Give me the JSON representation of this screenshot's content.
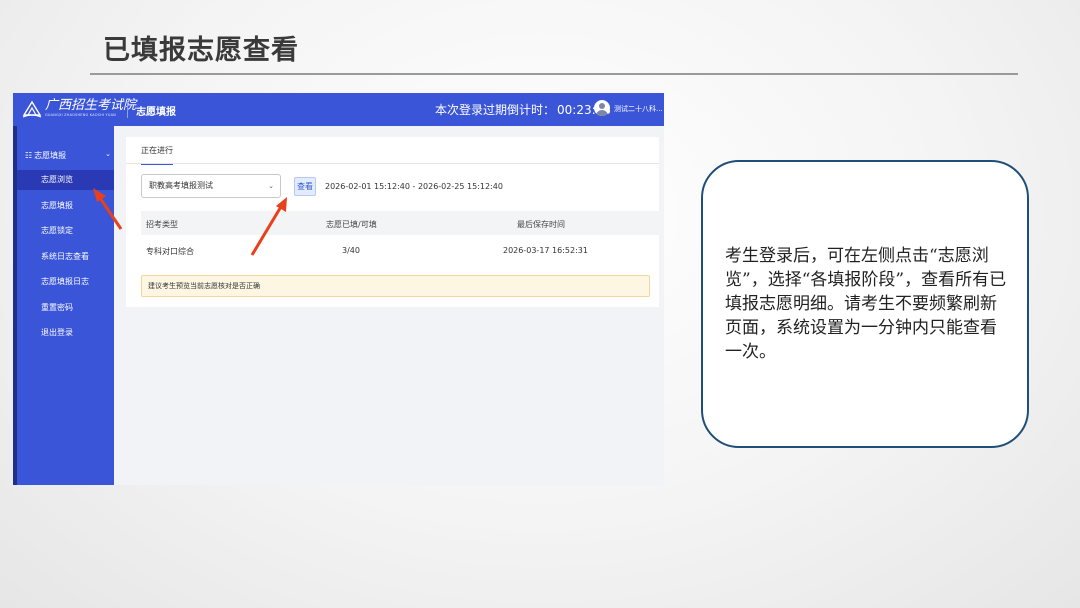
{
  "slide": {
    "title": "已填报志愿查看",
    "description": "考生登录后，可在左侧点击“志愿浏览”，选择“各填报阶段”，查看所有已填报志愿明细。请考生不要频繁刷新页面，系统设置为一分钟内只能查看一次。"
  },
  "app": {
    "logo_cn": "广西招生考试院",
    "logo_en": "GUANGXI ZHAOSHENG KAOSHI YUAN",
    "nav_title": "志愿填报",
    "countdown_label": "本次登录过期倒计时：",
    "countdown_time": "00:23:58",
    "username": "测试二十八科..."
  },
  "sidebar": {
    "group_label": "志愿填报",
    "group_icon": "grid-icon",
    "items": [
      {
        "label": "志愿浏览",
        "active": true
      },
      {
        "label": "志愿填报",
        "active": false
      },
      {
        "label": "志愿锁定",
        "active": false
      },
      {
        "label": "系统日志查看",
        "active": false
      },
      {
        "label": "志愿填报日志",
        "active": false
      },
      {
        "label": "重置密码",
        "active": false
      },
      {
        "label": "退出登录",
        "active": false
      }
    ]
  },
  "main": {
    "tab_label": "正在进行",
    "stage_select_value": "职教高考填报测试",
    "view_button": "查看",
    "date_range": "2026-02-01 15:12:40 - 2026-02-25 15:12:40",
    "table": {
      "headers": [
        "招考类型",
        "志愿已填/可填",
        "最后保存时间"
      ],
      "rows": [
        [
          "专科对口综合",
          "3/40",
          "2026-03-17 16:52:31"
        ]
      ]
    },
    "notice": "建议考生预览当前志愿核对是否正确"
  },
  "colors": {
    "primary": "#3a55d8",
    "arrow": "#e8401c",
    "callout_border": "#1f4e79"
  }
}
